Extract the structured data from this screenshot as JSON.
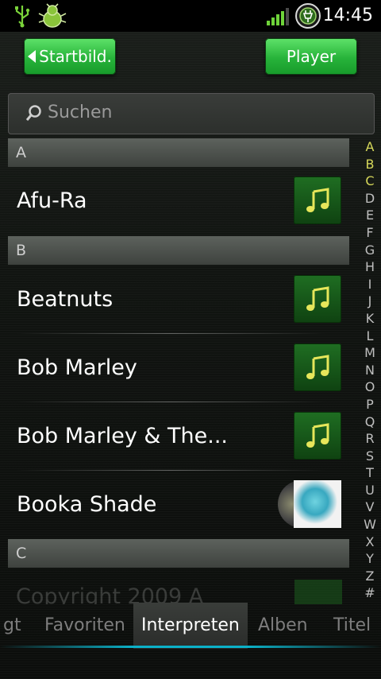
{
  "statusbar": {
    "time": "14:45",
    "icons": [
      "usb-icon",
      "debug-bug-icon",
      "signal-icon",
      "battery-charging-icon"
    ]
  },
  "toolbar": {
    "back_label": "Startbild.",
    "player_label": "Player"
  },
  "search": {
    "placeholder": "Suchen"
  },
  "list": {
    "section_a": "A",
    "section_b": "B",
    "section_c": "C",
    "items": [
      {
        "name": "Afu-Ra",
        "art": "music-note-icon"
      },
      {
        "name": "Beatnuts",
        "art": "music-note-icon"
      },
      {
        "name": "Bob Marley",
        "art": "music-note-icon"
      },
      {
        "name": "Bob Marley & The...",
        "art": "music-note-icon"
      },
      {
        "name": "Booka Shade",
        "art": "album-photo"
      }
    ],
    "faded_item": "Copyright 2009 A"
  },
  "alphabet": [
    "A",
    "B",
    "C",
    "D",
    "E",
    "F",
    "G",
    "H",
    "I",
    "J",
    "K",
    "L",
    "M",
    "N",
    "O",
    "P",
    "Q",
    "R",
    "S",
    "T",
    "U",
    "V",
    "W",
    "X",
    "Y",
    "Z",
    "#"
  ],
  "alphabet_highlight": [
    "A",
    "B",
    "C"
  ],
  "tabs": [
    {
      "label": "gt"
    },
    {
      "label": "Favoriten"
    },
    {
      "label": "Interpreten"
    },
    {
      "label": "Alben"
    },
    {
      "label": "Titel"
    }
  ],
  "colors": {
    "accent_green": "#27b33a",
    "tab_indicator": "#0bb1c8",
    "alphabet_highlight": "#d6d85a"
  }
}
